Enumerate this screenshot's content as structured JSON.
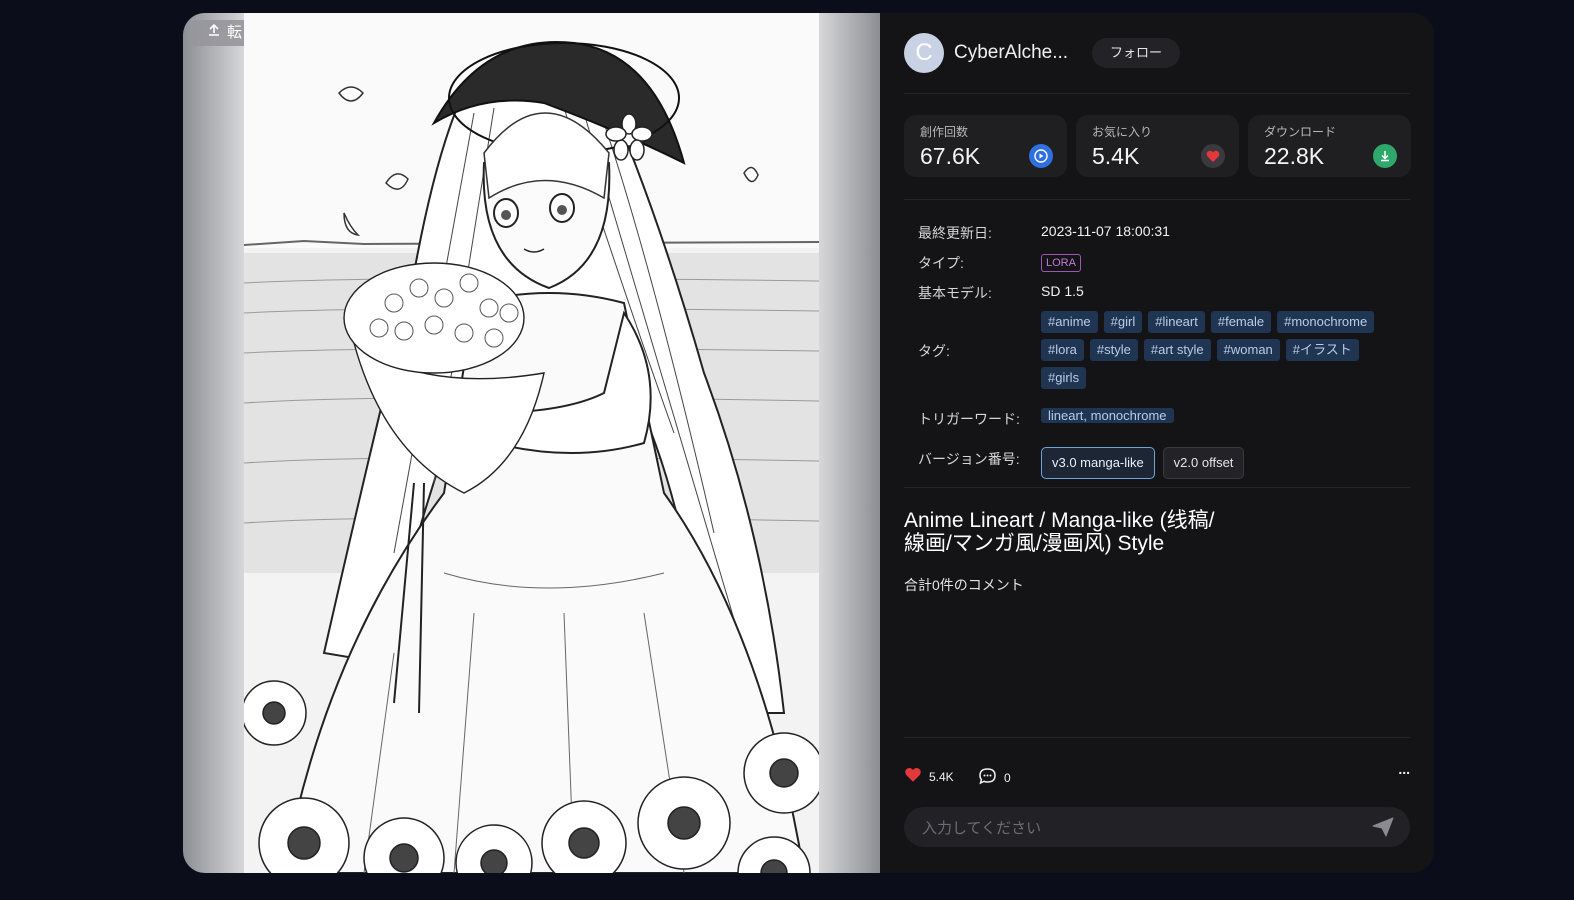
{
  "image": {
    "repost_label": "転"
  },
  "author": {
    "avatar_initial": "C",
    "name": "CyberAlche...",
    "follow_label": "フォロー"
  },
  "stats": [
    {
      "label": "創作回数",
      "value": "67.6K",
      "icon": "play-icon",
      "color": "#2f6fe0"
    },
    {
      "label": "お気に入り",
      "value": "5.4K",
      "icon": "heart-icon",
      "color": "#e5383b"
    },
    {
      "label": "ダウンロード",
      "value": "22.8K",
      "icon": "download-icon",
      "color": "#2fa86b"
    }
  ],
  "meta": {
    "updated_label": "最終更新日:",
    "updated_value": "2023-11-07 18:00:31",
    "type_label": "タイプ:",
    "type_value": "LORA",
    "base_model_label": "基本モデル:",
    "base_model_value": "SD 1.5",
    "tags_label": "タグ:",
    "tags": [
      "#anime",
      "#girl",
      "#lineart",
      "#female",
      "#monochrome",
      "#lora",
      "#style",
      "#art style",
      "#woman",
      "#イラスト",
      "#girls"
    ],
    "trigger_label": "トリガーワード:",
    "trigger_value": "lineart, monochrome",
    "version_label": "バージョン番号:",
    "versions": [
      "v3.0 manga-like",
      "v2.0 offset"
    ],
    "active_version": "v3.0 manga-like"
  },
  "title": "Anime Lineart / Manga-like (线稿/線画/マンガ風/漫画风) Style",
  "comment_count": "合計0件のコメント",
  "actions": {
    "likes": "5.4K",
    "comments": "0",
    "more": "..."
  },
  "comment_input": {
    "placeholder": "入力してください"
  }
}
